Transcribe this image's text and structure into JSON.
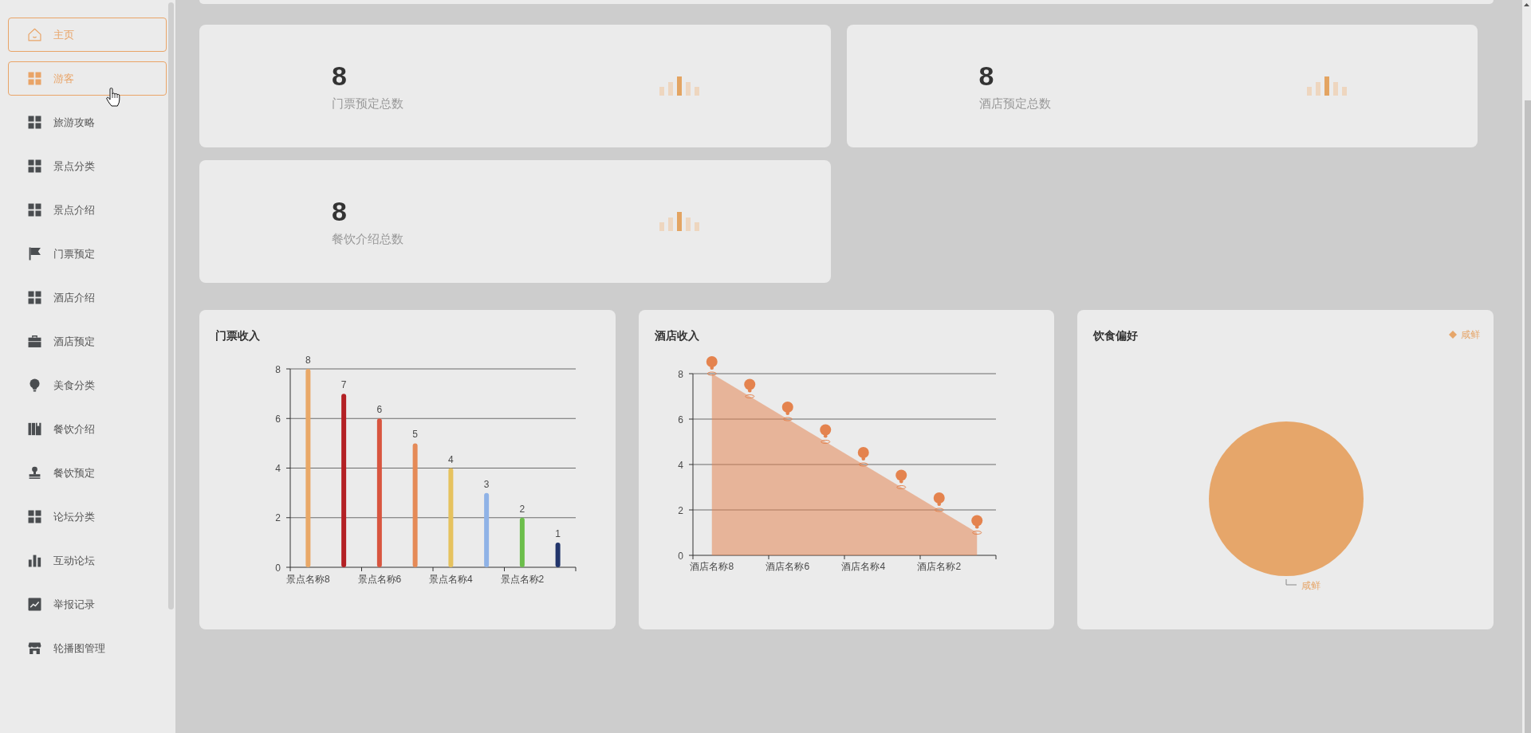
{
  "sidebar": {
    "items": [
      {
        "label": "主页",
        "selected": true,
        "hovered": false
      },
      {
        "label": "游客",
        "selected": true,
        "hovered": true
      },
      {
        "label": "旅游攻略",
        "selected": false,
        "hovered": false
      },
      {
        "label": "景点分类",
        "selected": false,
        "hovered": false
      },
      {
        "label": "景点介绍",
        "selected": false,
        "hovered": false
      },
      {
        "label": "门票预定",
        "selected": false,
        "hovered": false
      },
      {
        "label": "酒店介绍",
        "selected": false,
        "hovered": false
      },
      {
        "label": "酒店预定",
        "selected": false,
        "hovered": false
      },
      {
        "label": "美食分类",
        "selected": false,
        "hovered": false
      },
      {
        "label": "餐饮介绍",
        "selected": false,
        "hovered": false
      },
      {
        "label": "餐饮预定",
        "selected": false,
        "hovered": false
      },
      {
        "label": "论坛分类",
        "selected": false,
        "hovered": false
      },
      {
        "label": "互动论坛",
        "selected": false,
        "hovered": false
      },
      {
        "label": "举报记录",
        "selected": false,
        "hovered": false
      },
      {
        "label": "轮播图管理",
        "selected": false,
        "hovered": false
      }
    ]
  },
  "stats": [
    {
      "value": "8",
      "label": "门票预定总数"
    },
    {
      "value": "8",
      "label": "酒店预定总数"
    },
    {
      "value": "8",
      "label": "餐饮介绍总数"
    }
  ],
  "charts": [
    {
      "kind": "chart",
      "chart_data": {
        "type": "bar",
        "title": "门票收入",
        "categories": [
          "景点名称8",
          null,
          "景点名称6",
          null,
          "景点名称4",
          null,
          "景点名称2",
          null
        ],
        "values": [
          8,
          7,
          6,
          5,
          4,
          3,
          2,
          1
        ],
        "colors": [
          "#e9a867",
          "#b32024",
          "#d8553f",
          "#e58a57",
          "#e6c25e",
          "#8fb2e6",
          "#6cbe4b",
          "#22356b"
        ],
        "ylim": [
          0,
          8
        ],
        "yticks": [
          0,
          2,
          4,
          6,
          8
        ],
        "grid": true,
        "data_labels": true
      }
    },
    {
      "kind": "chart",
      "chart_data": {
        "type": "area",
        "title": "酒店收入",
        "categories": [
          "酒店名称8",
          null,
          "酒店名称6",
          null,
          "酒店名称4",
          null,
          "酒店名称2",
          null
        ],
        "series": [
          {
            "color": "#e4834e",
            "values": [
              8,
              7,
              6,
              5,
              4,
              3,
              2,
              1
            ]
          }
        ],
        "ylim": [
          0,
          8
        ],
        "yticks": [
          0,
          2,
          4,
          6,
          8
        ],
        "grid": true
      }
    },
    {
      "kind": "pie",
      "title": "饮食偏好",
      "legend": [
        {
          "label": "咸鲜",
          "color": "#e6a66a"
        }
      ],
      "slices": [
        {
          "label": "咸鲜",
          "color": "#e6a66a"
        }
      ]
    }
  ]
}
